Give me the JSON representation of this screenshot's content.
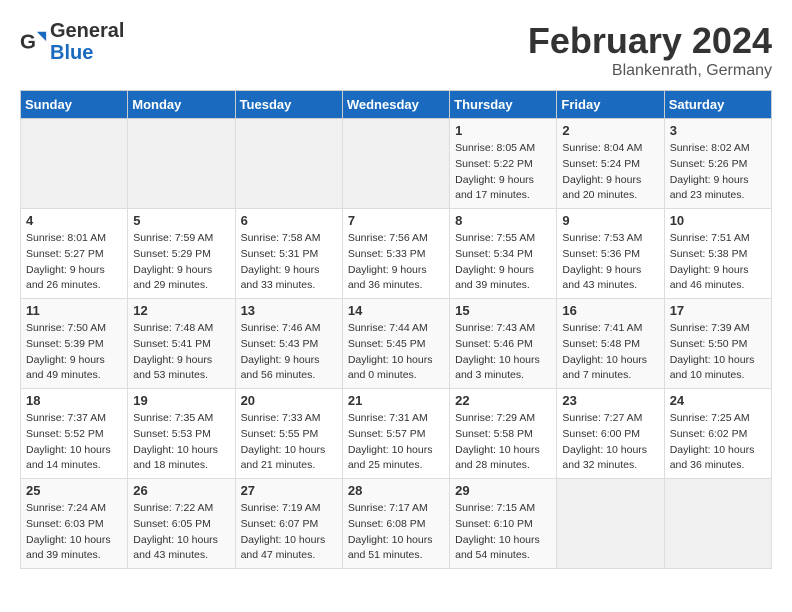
{
  "logo": {
    "line1": "General",
    "line2": "Blue"
  },
  "title": "February 2024",
  "location": "Blankenrath, Germany",
  "weekdays": [
    "Sunday",
    "Monday",
    "Tuesday",
    "Wednesday",
    "Thursday",
    "Friday",
    "Saturday"
  ],
  "weeks": [
    [
      {
        "day": "",
        "info": ""
      },
      {
        "day": "",
        "info": ""
      },
      {
        "day": "",
        "info": ""
      },
      {
        "day": "",
        "info": ""
      },
      {
        "day": "1",
        "info": "Sunrise: 8:05 AM\nSunset: 5:22 PM\nDaylight: 9 hours\nand 17 minutes."
      },
      {
        "day": "2",
        "info": "Sunrise: 8:04 AM\nSunset: 5:24 PM\nDaylight: 9 hours\nand 20 minutes."
      },
      {
        "day": "3",
        "info": "Sunrise: 8:02 AM\nSunset: 5:26 PM\nDaylight: 9 hours\nand 23 minutes."
      }
    ],
    [
      {
        "day": "4",
        "info": "Sunrise: 8:01 AM\nSunset: 5:27 PM\nDaylight: 9 hours\nand 26 minutes."
      },
      {
        "day": "5",
        "info": "Sunrise: 7:59 AM\nSunset: 5:29 PM\nDaylight: 9 hours\nand 29 minutes."
      },
      {
        "day": "6",
        "info": "Sunrise: 7:58 AM\nSunset: 5:31 PM\nDaylight: 9 hours\nand 33 minutes."
      },
      {
        "day": "7",
        "info": "Sunrise: 7:56 AM\nSunset: 5:33 PM\nDaylight: 9 hours\nand 36 minutes."
      },
      {
        "day": "8",
        "info": "Sunrise: 7:55 AM\nSunset: 5:34 PM\nDaylight: 9 hours\nand 39 minutes."
      },
      {
        "day": "9",
        "info": "Sunrise: 7:53 AM\nSunset: 5:36 PM\nDaylight: 9 hours\nand 43 minutes."
      },
      {
        "day": "10",
        "info": "Sunrise: 7:51 AM\nSunset: 5:38 PM\nDaylight: 9 hours\nand 46 minutes."
      }
    ],
    [
      {
        "day": "11",
        "info": "Sunrise: 7:50 AM\nSunset: 5:39 PM\nDaylight: 9 hours\nand 49 minutes."
      },
      {
        "day": "12",
        "info": "Sunrise: 7:48 AM\nSunset: 5:41 PM\nDaylight: 9 hours\nand 53 minutes."
      },
      {
        "day": "13",
        "info": "Sunrise: 7:46 AM\nSunset: 5:43 PM\nDaylight: 9 hours\nand 56 minutes."
      },
      {
        "day": "14",
        "info": "Sunrise: 7:44 AM\nSunset: 5:45 PM\nDaylight: 10 hours\nand 0 minutes."
      },
      {
        "day": "15",
        "info": "Sunrise: 7:43 AM\nSunset: 5:46 PM\nDaylight: 10 hours\nand 3 minutes."
      },
      {
        "day": "16",
        "info": "Sunrise: 7:41 AM\nSunset: 5:48 PM\nDaylight: 10 hours\nand 7 minutes."
      },
      {
        "day": "17",
        "info": "Sunrise: 7:39 AM\nSunset: 5:50 PM\nDaylight: 10 hours\nand 10 minutes."
      }
    ],
    [
      {
        "day": "18",
        "info": "Sunrise: 7:37 AM\nSunset: 5:52 PM\nDaylight: 10 hours\nand 14 minutes."
      },
      {
        "day": "19",
        "info": "Sunrise: 7:35 AM\nSunset: 5:53 PM\nDaylight: 10 hours\nand 18 minutes."
      },
      {
        "day": "20",
        "info": "Sunrise: 7:33 AM\nSunset: 5:55 PM\nDaylight: 10 hours\nand 21 minutes."
      },
      {
        "day": "21",
        "info": "Sunrise: 7:31 AM\nSunset: 5:57 PM\nDaylight: 10 hours\nand 25 minutes."
      },
      {
        "day": "22",
        "info": "Sunrise: 7:29 AM\nSunset: 5:58 PM\nDaylight: 10 hours\nand 28 minutes."
      },
      {
        "day": "23",
        "info": "Sunrise: 7:27 AM\nSunset: 6:00 PM\nDaylight: 10 hours\nand 32 minutes."
      },
      {
        "day": "24",
        "info": "Sunrise: 7:25 AM\nSunset: 6:02 PM\nDaylight: 10 hours\nand 36 minutes."
      }
    ],
    [
      {
        "day": "25",
        "info": "Sunrise: 7:24 AM\nSunset: 6:03 PM\nDaylight: 10 hours\nand 39 minutes."
      },
      {
        "day": "26",
        "info": "Sunrise: 7:22 AM\nSunset: 6:05 PM\nDaylight: 10 hours\nand 43 minutes."
      },
      {
        "day": "27",
        "info": "Sunrise: 7:19 AM\nSunset: 6:07 PM\nDaylight: 10 hours\nand 47 minutes."
      },
      {
        "day": "28",
        "info": "Sunrise: 7:17 AM\nSunset: 6:08 PM\nDaylight: 10 hours\nand 51 minutes."
      },
      {
        "day": "29",
        "info": "Sunrise: 7:15 AM\nSunset: 6:10 PM\nDaylight: 10 hours\nand 54 minutes."
      },
      {
        "day": "",
        "info": ""
      },
      {
        "day": "",
        "info": ""
      }
    ]
  ]
}
